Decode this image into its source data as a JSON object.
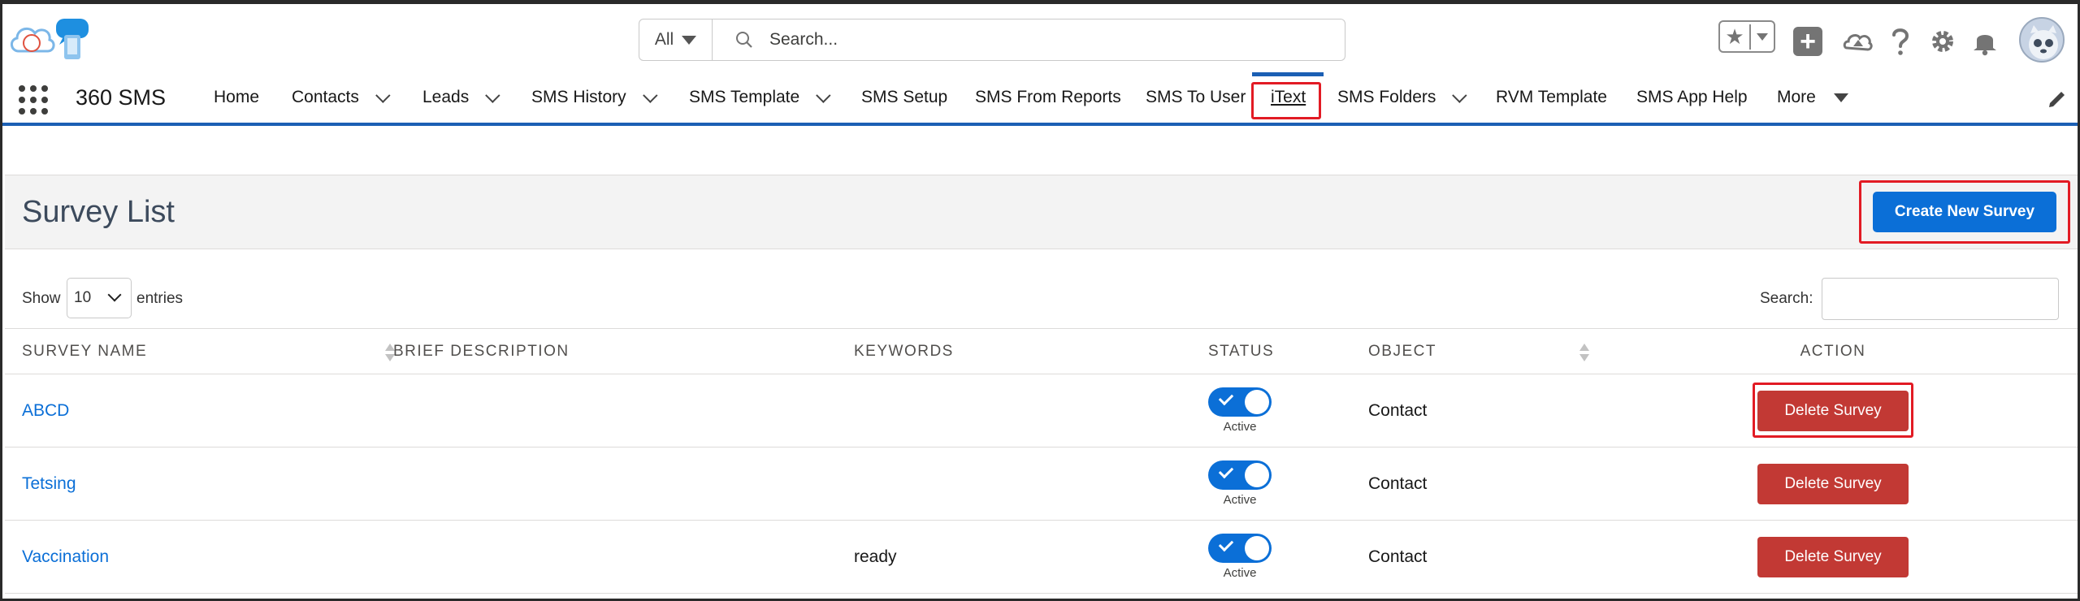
{
  "header": {
    "search_scope": "All",
    "search_placeholder": "Search...",
    "icons": [
      "star-icon",
      "plus-icon",
      "trailhead-icon",
      "help-icon",
      "gear-icon",
      "bell-icon",
      "avatar"
    ]
  },
  "nav": {
    "app_name": "360 SMS",
    "items": [
      {
        "label": "Home",
        "dropdown": false
      },
      {
        "label": "Contacts",
        "dropdown": true
      },
      {
        "label": "Leads",
        "dropdown": true
      },
      {
        "label": "SMS History",
        "dropdown": true
      },
      {
        "label": "SMS Template",
        "dropdown": true
      },
      {
        "label": "SMS Setup",
        "dropdown": false
      },
      {
        "label": "SMS From Reports",
        "dropdown": false
      },
      {
        "label": "SMS To User",
        "dropdown": false
      },
      {
        "label": "iText",
        "dropdown": false,
        "active": true
      },
      {
        "label": "SMS Folders",
        "dropdown": true
      },
      {
        "label": "RVM Template",
        "dropdown": false
      },
      {
        "label": "SMS App Help",
        "dropdown": false
      },
      {
        "label": "More",
        "dropdown": true
      }
    ]
  },
  "survey": {
    "title": "Survey List",
    "create_label": "Create New Survey",
    "show_label": "Show",
    "entries_value": "10",
    "entries_label": "entries",
    "search_label": "Search:",
    "columns": [
      "SURVEY NAME",
      "BRIEF DESCRIPTION",
      "KEYWORDS",
      "STATUS",
      "OBJECT",
      "ACTION"
    ],
    "rows": [
      {
        "name": "ABCD",
        "description": "",
        "keywords": "",
        "status": "Active",
        "object": "Contact",
        "action": "Delete Survey"
      },
      {
        "name": "Tetsing",
        "description": "",
        "keywords": "",
        "status": "Active",
        "object": "Contact",
        "action": "Delete Survey"
      },
      {
        "name": "Vaccination",
        "description": "",
        "keywords": "ready",
        "status": "Active",
        "object": "Contact",
        "action": "Delete Survey"
      }
    ]
  },
  "colors": {
    "brand_blue": "#0b6fd7",
    "danger_red": "#c23934",
    "highlight_red": "#e21b24"
  }
}
